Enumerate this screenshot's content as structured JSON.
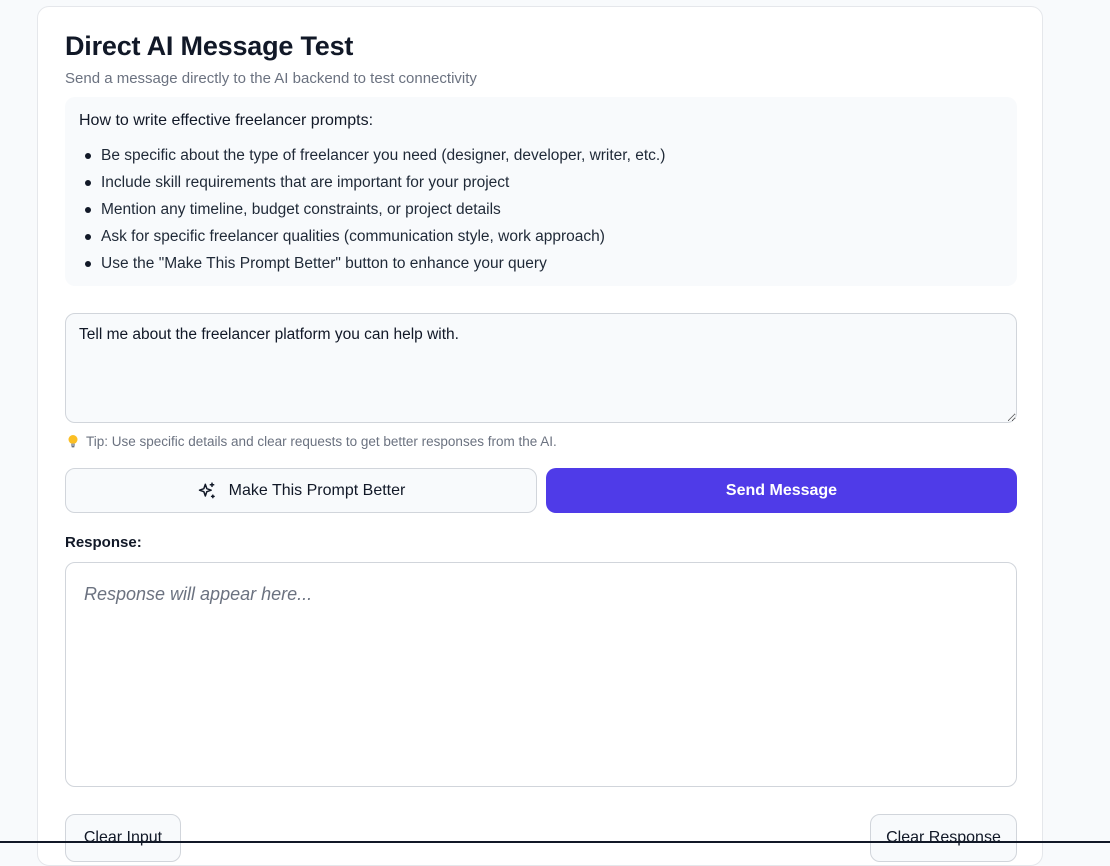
{
  "header": {
    "title": "Direct AI Message Test",
    "subtitle": "Send a message directly to the AI backend to test connectivity"
  },
  "tips": {
    "heading": "How to write effective freelancer prompts:",
    "items": [
      "Be specific about the type of freelancer you need (designer, developer, writer, etc.)",
      "Include skill requirements that are important for your project",
      "Mention any timeline, budget constraints, or project details",
      "Ask for specific freelancer qualities (communication style, work approach)",
      "Use the \"Make This Prompt Better\" button to enhance your query"
    ]
  },
  "message": {
    "value": "Tell me about the freelancer platform you can help with."
  },
  "hint": {
    "icon": "lightbulb-icon",
    "text": "Tip: Use specific details and clear requests to get better responses from the AI."
  },
  "actions": {
    "improve_icon": "sparkles-icon",
    "improve_label": "Make This Prompt Better",
    "send_label": "Send Message",
    "send_color": "#4f3be8"
  },
  "response": {
    "label": "Response:",
    "placeholder": "Response will appear here..."
  },
  "footer": {
    "clear_input_label": "Clear Input",
    "clear_response_label": "Clear Response"
  }
}
